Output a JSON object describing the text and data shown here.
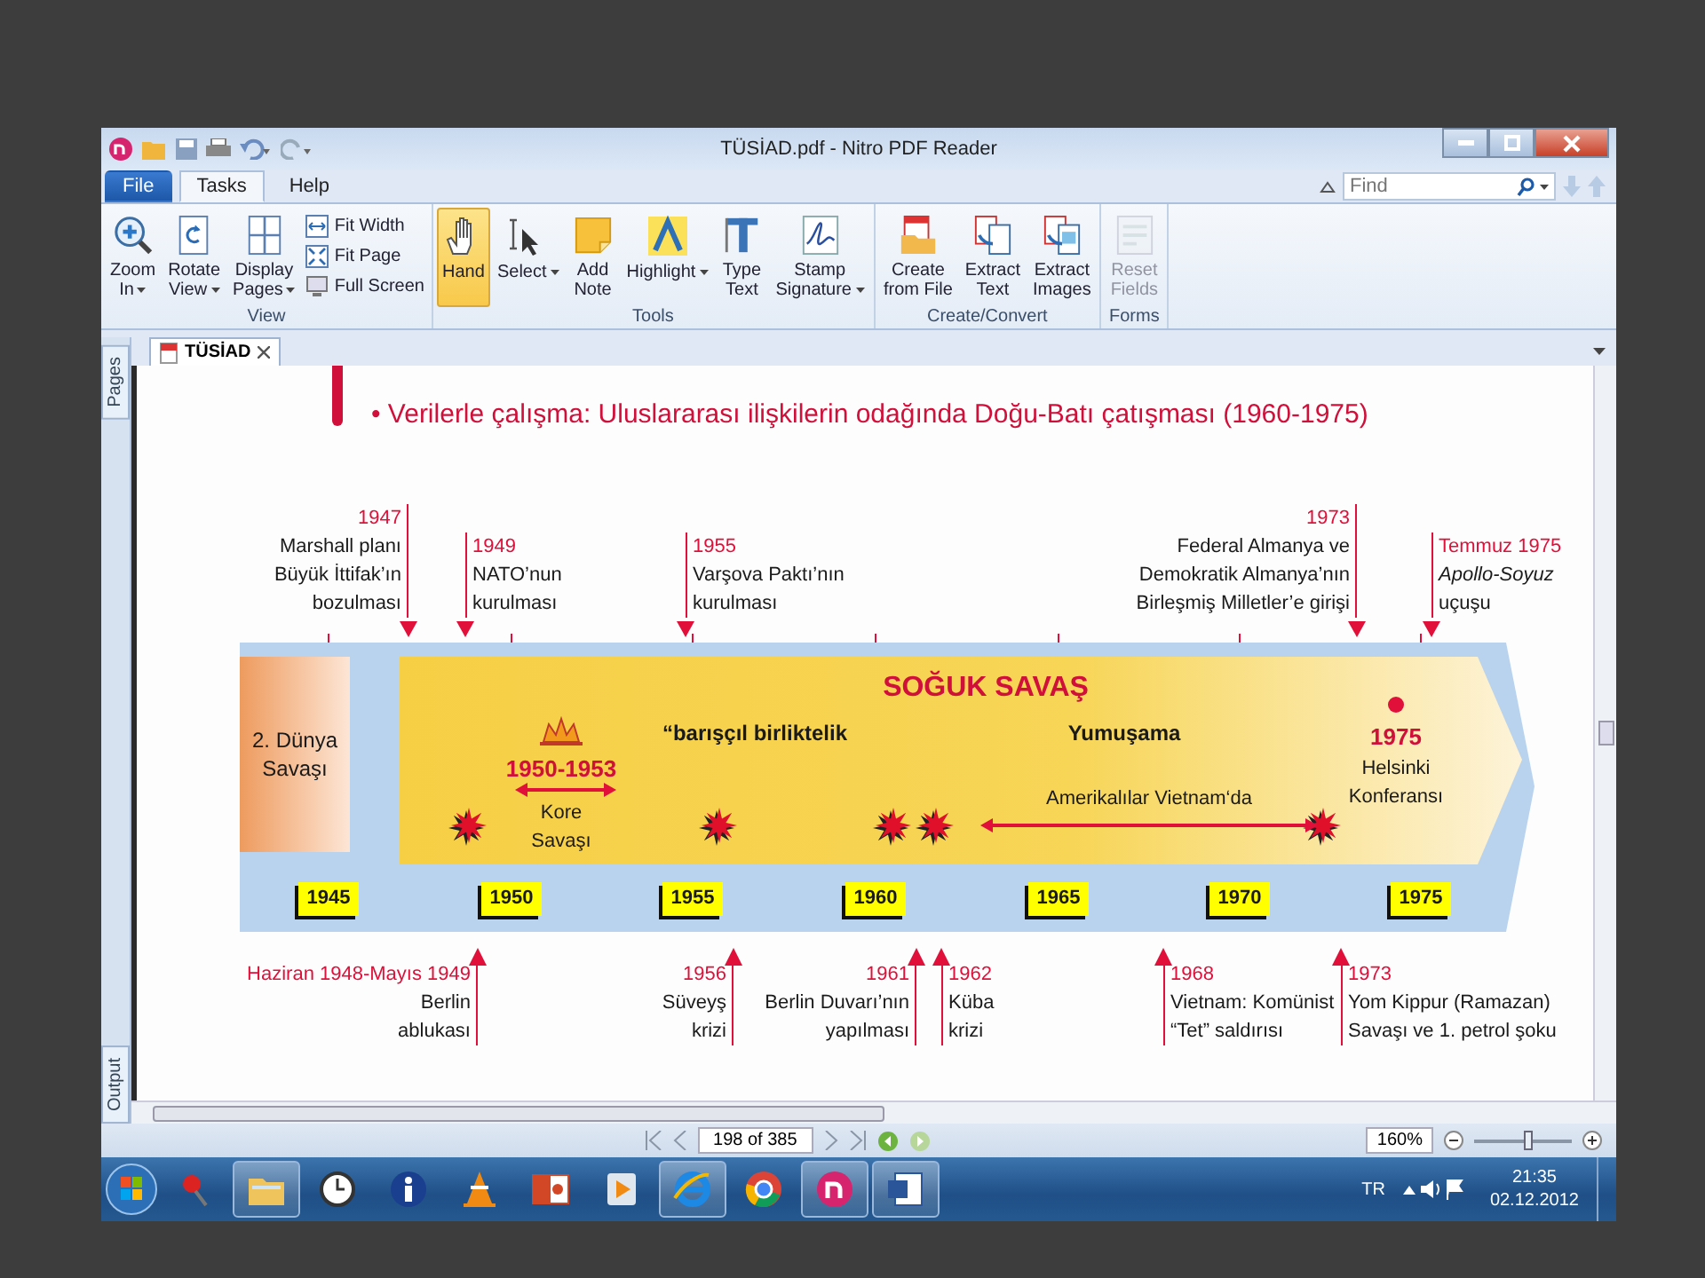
{
  "window": {
    "title": "TÜSİAD.pdf - Nitro PDF Reader"
  },
  "ribbon": {
    "tabs": [
      {
        "label": "File",
        "kind": "menu",
        "selected": false
      },
      {
        "label": "Tasks",
        "kind": "tab",
        "selected": true
      },
      {
        "label": "Help",
        "kind": "tab",
        "selected": false
      }
    ],
    "search": {
      "placeholder": "Find"
    },
    "groups": [
      {
        "label": "View",
        "buttons": [
          {
            "kind": "large",
            "lines": [
              "Zoom",
              "In"
            ],
            "dropdown": true,
            "selected": false,
            "disabled": false
          },
          {
            "kind": "large",
            "lines": [
              "Rotate",
              "View"
            ],
            "dropdown": true,
            "selected": false,
            "disabled": false
          },
          {
            "kind": "large",
            "lines": [
              "Display",
              "Pages"
            ],
            "dropdown": true,
            "selected": false,
            "disabled": false
          },
          {
            "kind": "small",
            "lines": [
              "Fit Width"
            ],
            "selected": false,
            "disabled": false
          },
          {
            "kind": "small",
            "lines": [
              "Fit Page"
            ],
            "selected": false,
            "disabled": false
          },
          {
            "kind": "small",
            "lines": [
              "Full Screen"
            ],
            "selected": false,
            "disabled": false
          }
        ]
      },
      {
        "label": "Tools",
        "buttons": [
          {
            "kind": "large",
            "lines": [
              "Hand"
            ],
            "dropdown": false,
            "selected": true,
            "disabled": false
          },
          {
            "kind": "large",
            "lines": [
              "Select"
            ],
            "dropdown": true,
            "selected": false,
            "disabled": false
          },
          {
            "kind": "large",
            "lines": [
              "Add",
              "Note"
            ],
            "dropdown": false,
            "selected": false,
            "disabled": false
          },
          {
            "kind": "large",
            "lines": [
              "Highlight"
            ],
            "dropdown": true,
            "selected": false,
            "disabled": false
          },
          {
            "kind": "large",
            "lines": [
              "Type",
              "Text"
            ],
            "dropdown": false,
            "selected": false,
            "disabled": false
          },
          {
            "kind": "large",
            "lines": [
              "Stamp",
              "Signature"
            ],
            "dropdown": true,
            "selected": false,
            "disabled": false
          }
        ]
      },
      {
        "label": "Create/Convert",
        "buttons": [
          {
            "kind": "large",
            "lines": [
              "Create",
              "from File"
            ],
            "dropdown": false,
            "selected": false,
            "disabled": false
          },
          {
            "kind": "large",
            "lines": [
              "Extract",
              "Text"
            ],
            "dropdown": false,
            "selected": false,
            "disabled": false
          },
          {
            "kind": "large",
            "lines": [
              "Extract",
              "Images"
            ],
            "dropdown": false,
            "selected": false,
            "disabled": false
          }
        ]
      },
      {
        "label": "Forms",
        "buttons": [
          {
            "kind": "large",
            "lines": [
              "Reset",
              "Fields"
            ],
            "dropdown": false,
            "selected": false,
            "disabled": true
          }
        ]
      }
    ]
  },
  "side_tabs": [
    "Pages",
    "Output"
  ],
  "document_tab": {
    "label": "TÜSİAD"
  },
  "document": {
    "bullet": "• Verilerle çalışma: Uluslararası ilişkilerin odağında Doğu-Batı çatışması (1960-1975)",
    "timeline": {
      "era_box": [
        "2. Dünya",
        "Savaşı"
      ],
      "band_title": "SOĞUK SAVAŞ",
      "phases": [
        "“barışçıl birliktelik",
        "Yumuşama"
      ],
      "korea": {
        "date": "1950-1953",
        "lines": [
          "Kore",
          "Savaşı"
        ]
      },
      "vietnam": "Amerikalılar Vietnam‘da",
      "helsinki": {
        "date": "1975",
        "lines": [
          "Helsinki",
          "Konferansı"
        ]
      },
      "years": [
        "1945",
        "1950",
        "1955",
        "1960",
        "1965",
        "1970",
        "1975"
      ],
      "events_above": [
        {
          "date": "1947",
          "lines": [
            "Marshall planı",
            "Büyük İttifak’ın",
            "bozulması"
          ]
        },
        {
          "date": "1949",
          "lines": [
            "NATO’nun",
            "kurulması"
          ]
        },
        {
          "date": "1955",
          "lines": [
            "Varşova Paktı’nın",
            "kurulması"
          ]
        },
        {
          "date": "1973",
          "lines": [
            "Federal Almanya ve",
            "Demokratik Almanya’nın",
            "Birleşmiş Milletler’e girişi"
          ]
        },
        {
          "date": "Temmuz 1975",
          "lines": [
            "*Apollo-Soyuz*",
            "uçuşu"
          ]
        }
      ],
      "events_below": [
        {
          "date": "Haziran 1948-Mayıs 1949",
          "lines": [
            "Berlin",
            "ablukası"
          ]
        },
        {
          "date": "1956",
          "lines": [
            "Süveyş",
            "krizi"
          ]
        },
        {
          "date": "1961",
          "lines": [
            "Berlin Duvarı’nın",
            "yapılması"
          ]
        },
        {
          "date": "1962",
          "lines": [
            "Küba",
            "krizi"
          ]
        },
        {
          "date": "1968",
          "lines": [
            "Vietnam: Komünist",
            "“Tet” saldırısı"
          ]
        },
        {
          "date": "1973",
          "lines": [
            "Yom Kippur (Ramazan)",
            "Savaşı ve 1. petrol şoku"
          ]
        }
      ]
    }
  },
  "status_bar": {
    "page": "198 of 385",
    "zoom": "160%",
    "zoom_slider": {
      "level": 0.55
    }
  },
  "taskbar": {
    "apps": [
      {
        "running": false
      },
      {
        "running": true
      },
      {
        "running": false
      },
      {
        "running": false
      },
      {
        "running": false
      },
      {
        "running": false
      },
      {
        "running": false
      },
      {
        "running": true
      },
      {
        "running": false
      },
      {
        "running": true
      },
      {
        "running": true
      }
    ],
    "language": "TR",
    "time": "21:35",
    "date": "02.12.2012"
  }
}
